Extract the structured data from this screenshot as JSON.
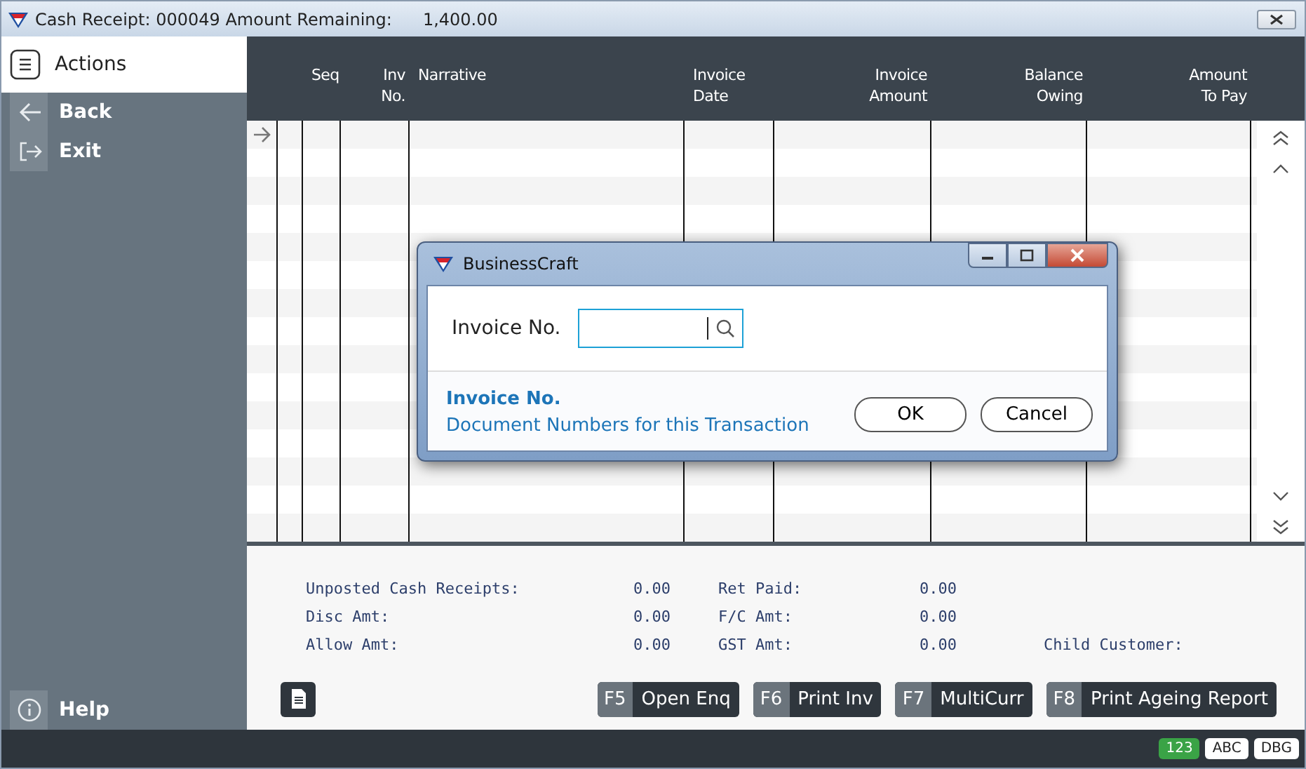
{
  "window": {
    "title": "Cash Receipt: 000049 Amount Remaining:",
    "amount_remaining": "1,400.00"
  },
  "sidebar": {
    "header": "Actions",
    "items": [
      {
        "label": "Back",
        "kind": "back"
      },
      {
        "label": "Exit",
        "kind": "exit"
      }
    ],
    "help": "Help"
  },
  "grid": {
    "columns": [
      {
        "lines": [
          "Seq"
        ]
      },
      {
        "lines": [
          "Inv",
          "No."
        ]
      },
      {
        "lines": [
          "Narrative"
        ]
      },
      {
        "lines": [
          "Invoice",
          "Date"
        ]
      },
      {
        "lines": [
          "Invoice",
          "Amount"
        ]
      },
      {
        "lines": [
          "Balance",
          "Owing"
        ]
      },
      {
        "lines": [
          "Amount",
          "To Pay"
        ]
      }
    ]
  },
  "summary": {
    "rows": [
      [
        {
          "label": "Unposted Cash Receipts:",
          "value": "0.00"
        },
        {
          "label": "Ret Paid:",
          "value": "0.00"
        }
      ],
      [
        {
          "label": "Disc Amt:",
          "value": "0.00"
        },
        {
          "label": "F/C Amt:",
          "value": "0.00"
        }
      ],
      [
        {
          "label": "Allow Amt:",
          "value": "0.00"
        },
        {
          "label": "GST Amt:",
          "value": "0.00"
        },
        {
          "label": "Child Customer:"
        }
      ]
    ]
  },
  "function_keys": [
    {
      "key": "F5",
      "label": "Open Enq"
    },
    {
      "key": "F6",
      "label": "Print Inv"
    },
    {
      "key": "F7",
      "label": "MultiCurr"
    },
    {
      "key": "F8",
      "label": "Print Ageing Report"
    }
  ],
  "status_indicators": [
    {
      "label": "123",
      "on": true
    },
    {
      "label": "ABC",
      "on": false
    },
    {
      "label": "DBG",
      "on": false
    }
  ],
  "dialog": {
    "title": "BusinessCraft",
    "field_label": "Invoice No.",
    "hint_title": "Invoice No.",
    "hint_text": "Document Numbers for this Transaction",
    "buttons": [
      "OK",
      "Cancel"
    ]
  }
}
